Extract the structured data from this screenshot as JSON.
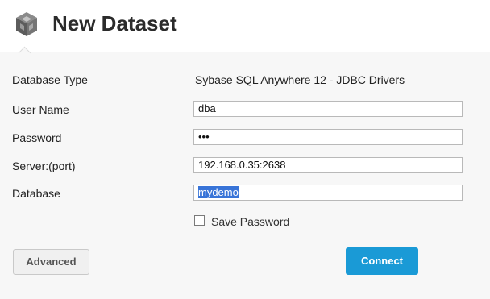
{
  "header": {
    "title": "New Dataset",
    "icon": "cube-icon"
  },
  "form": {
    "database_type": {
      "label": "Database Type",
      "value": "Sybase SQL Anywhere 12 - JDBC Drivers"
    },
    "user_name": {
      "label": "User Name",
      "value": "dba"
    },
    "password": {
      "label": "Password",
      "value": "•••"
    },
    "server": {
      "label": "Server:(port)",
      "value": "192.168.0.35:2638"
    },
    "database": {
      "label": "Database",
      "value": "mydemo"
    },
    "save_password": {
      "label": "Save Password",
      "checked": false
    }
  },
  "buttons": {
    "advanced": "Advanced",
    "connect": "Connect"
  },
  "colors": {
    "accent": "#1a9ad6",
    "selection": "#3874d8"
  }
}
